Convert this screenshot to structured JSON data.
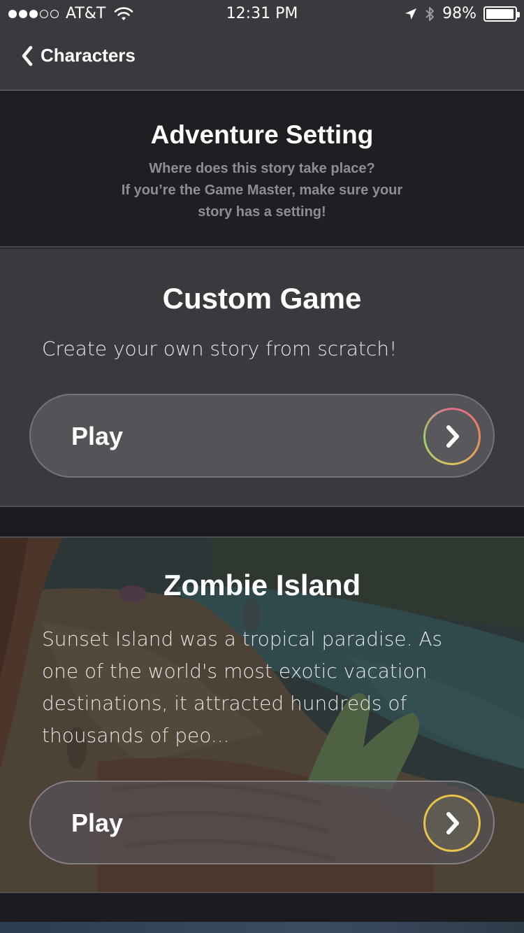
{
  "status_bar": {
    "carrier": "AT&T",
    "time": "12:31 PM",
    "battery": "98%",
    "battery_level": 0.98,
    "signal_bars_filled": 3,
    "signal_bars_total": 5
  },
  "nav": {
    "back_label": "Characters"
  },
  "header": {
    "title": "Adventure Setting",
    "subtitle_line1": "Where does this story take place?",
    "subtitle_line2": "If you’re the Game Master, make sure your",
    "subtitle_line3": "story has a setting!"
  },
  "cards": [
    {
      "title": "Custom Game",
      "description": "Create your own story from scratch!",
      "button_label": "Play"
    },
    {
      "title": "Zombie Island",
      "description": "Sunset Island was a tropical paradise. As one of the world's most exotic vacation destinations, it attracted hundreds of thousands of peo...",
      "button_label": "Play"
    }
  ],
  "colors": {
    "topbar": "#3a3a3e",
    "header_bg": "#1f1f23",
    "card_bg": "#3a3a3e",
    "ring_custom_start": "#e36a8a",
    "ring_custom_end": "#9bd06a",
    "ring_zombie": "#e8c24a"
  },
  "icons": {
    "back": "chevron-left-icon",
    "play": "chevron-right-icon",
    "wifi": "wifi-icon",
    "location": "location-arrow-icon",
    "bluetooth": "bluetooth-icon"
  }
}
